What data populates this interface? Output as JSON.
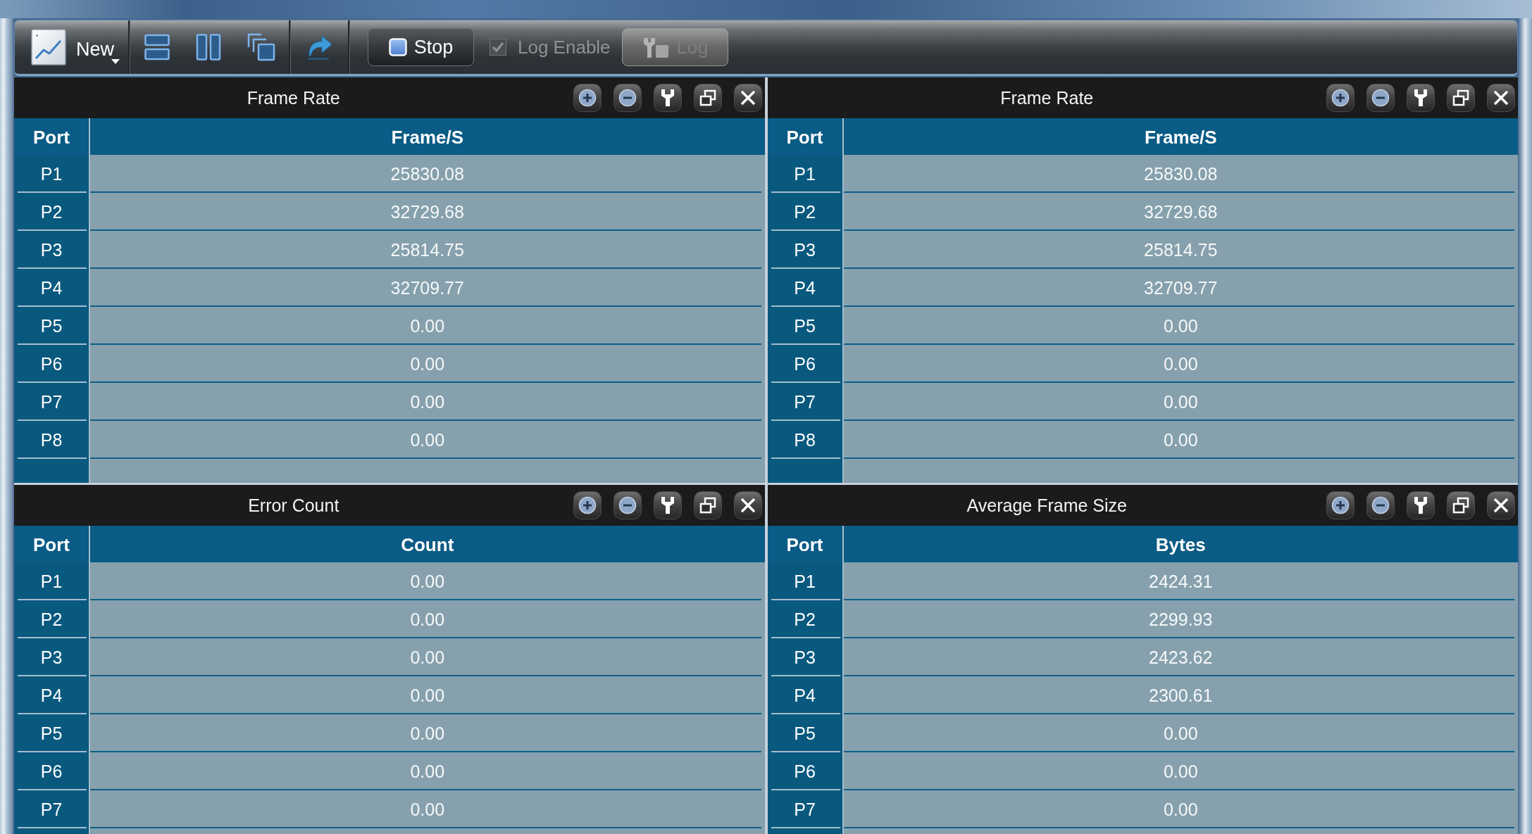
{
  "toolbar": {
    "new_button": {
      "label": "New"
    },
    "stop_button": {
      "label": "Stop"
    },
    "log_enable": {
      "label": "Log Enable",
      "checked": true,
      "disabled": true
    },
    "log_button": {
      "label": "Log",
      "disabled": true
    }
  },
  "panels": [
    {
      "title": "Frame Rate",
      "columns": [
        "Port",
        "Frame/S"
      ],
      "rows": [
        [
          "P1",
          "25830.08"
        ],
        [
          "P2",
          "32729.68"
        ],
        [
          "P3",
          "25814.75"
        ],
        [
          "P4",
          "32709.77"
        ],
        [
          "P5",
          "0.00"
        ],
        [
          "P6",
          "0.00"
        ],
        [
          "P7",
          "0.00"
        ],
        [
          "P8",
          "0.00"
        ]
      ]
    },
    {
      "title": "Frame Rate",
      "columns": [
        "Port",
        "Frame/S"
      ],
      "rows": [
        [
          "P1",
          "25830.08"
        ],
        [
          "P2",
          "32729.68"
        ],
        [
          "P3",
          "25814.75"
        ],
        [
          "P4",
          "32709.77"
        ],
        [
          "P5",
          "0.00"
        ],
        [
          "P6",
          "0.00"
        ],
        [
          "P7",
          "0.00"
        ],
        [
          "P8",
          "0.00"
        ]
      ]
    },
    {
      "title": "Error Count",
      "columns": [
        "Port",
        "Count"
      ],
      "rows": [
        [
          "P1",
          "0.00"
        ],
        [
          "P2",
          "0.00"
        ],
        [
          "P3",
          "0.00"
        ],
        [
          "P4",
          "0.00"
        ],
        [
          "P5",
          "0.00"
        ],
        [
          "P6",
          "0.00"
        ],
        [
          "P7",
          "0.00"
        ]
      ]
    },
    {
      "title": "Average Frame Size",
      "columns": [
        "Port",
        "Bytes"
      ],
      "rows": [
        [
          "P1",
          "2424.31"
        ],
        [
          "P2",
          "2299.93"
        ],
        [
          "P3",
          "2423.62"
        ],
        [
          "P4",
          "2300.61"
        ],
        [
          "P5",
          "0.00"
        ],
        [
          "P6",
          "0.00"
        ],
        [
          "P7",
          "0.00"
        ]
      ]
    }
  ]
}
